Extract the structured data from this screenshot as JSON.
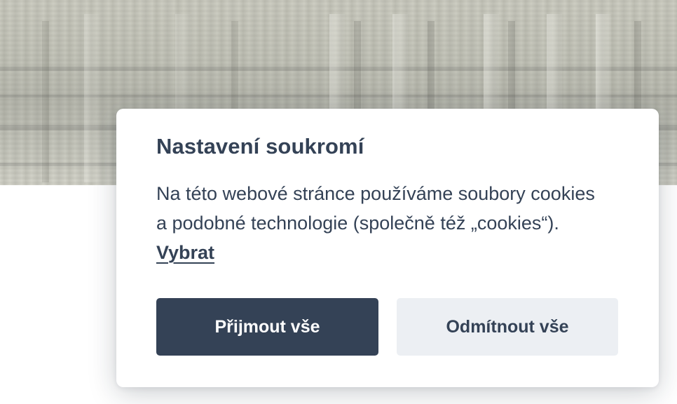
{
  "cookie_banner": {
    "title": "Nastavení soukromí",
    "text": "Na této webové stránce používáme soubory cookies a podobné technologie (společně též „cookies“).",
    "choose_link": "Vybrat",
    "accept_all_label": "Přijmout vše",
    "reject_all_label": "Odmítnout vše"
  },
  "colors": {
    "primary": "#344256",
    "secondary_button_bg": "#eceff3",
    "dialog_bg": "#ffffff"
  }
}
